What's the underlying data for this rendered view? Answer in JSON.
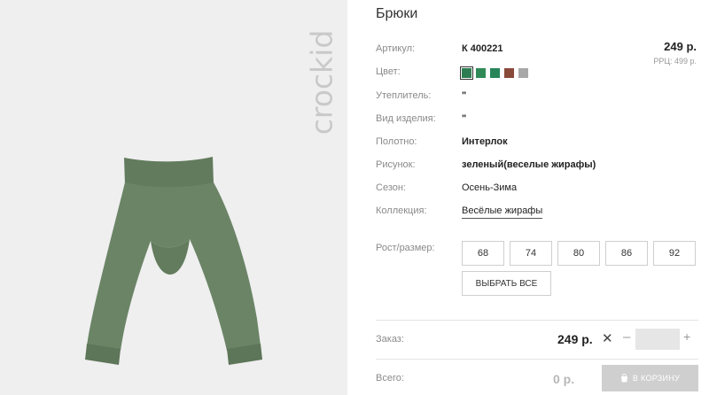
{
  "brand": {
    "logo_text": "crockid"
  },
  "product": {
    "title": "Брюки",
    "price": "249 р.",
    "rrp": "РРЦ: 499 р."
  },
  "attributes": {
    "article": {
      "label": "Артикул:",
      "value": "К 400221"
    },
    "color": {
      "label": "Цвет:"
    },
    "insulation": {
      "label": "Утеплитель:",
      "value": "\""
    },
    "item_type": {
      "label": "Вид изделия:",
      "value": "\""
    },
    "fabric": {
      "label": "Полотно:",
      "value": "Интерлок"
    },
    "pattern": {
      "label": "Рисунок:",
      "value": "зеленый(веселые жирафы)"
    },
    "season": {
      "label": "Сезон:",
      "value": "Осень-Зима"
    },
    "collection": {
      "label": "Коллекция:",
      "value": "Весёлые жирафы"
    }
  },
  "swatches": [
    {
      "color": "#2e7d52",
      "selected": true
    },
    {
      "color": "#2f8a57",
      "selected": false
    },
    {
      "color": "#27855a",
      "selected": false
    },
    {
      "color": "#8a4a3a",
      "selected": false
    },
    {
      "color": "#a8a8a8",
      "selected": false
    }
  ],
  "sizes": {
    "label": "Рост/размер:",
    "options": [
      "68",
      "74",
      "80",
      "86",
      "92"
    ],
    "select_all": "ВЫБРАТЬ ВСЕ"
  },
  "order": {
    "label": "Заказ:",
    "price": "249 р.",
    "times": "✕",
    "minus": "–",
    "plus": "+",
    "qty_value": ""
  },
  "total": {
    "label": "Всего:",
    "value": "0 р.",
    "cart_button": "В КОРЗИНУ"
  },
  "colors": {
    "pants": "#6b8466",
    "pants_dark": "#5d7558",
    "photo_bg": "#efefef"
  }
}
